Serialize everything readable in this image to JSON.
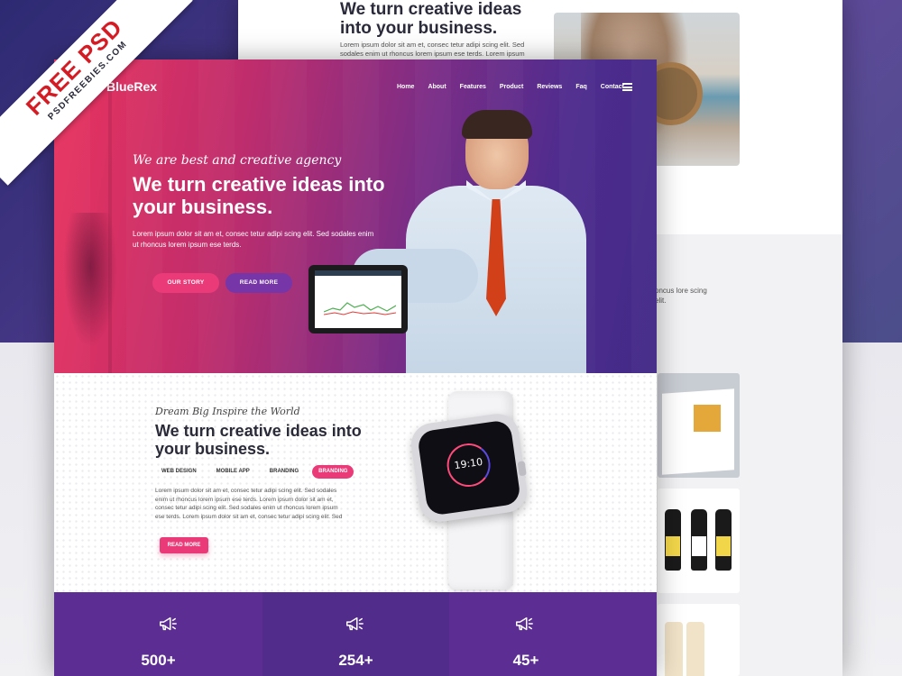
{
  "badge": {
    "main": "FREE PSD",
    "sub": "PSDFREEBIES.COM"
  },
  "back_page": {
    "title": "We  turn creative ideas into your business.",
    "text": "Lorem ipsum dolor sit am et, consec tetur adipi scing elit. Sed sodales enim ut rhoncus lorem ipsum ese terds. Lorem ipsum",
    "side_text": "oncus lore scing elit."
  },
  "header": {
    "logo": "BlueRex",
    "nav": [
      "Home",
      "About",
      "Features",
      "Product",
      "Reviews",
      "Faq",
      "Contact"
    ]
  },
  "hero": {
    "tagline": "We are best and creative agency",
    "title": "We  turn creative ideas into your business.",
    "text": "Lorem ipsum dolor sit am et, consec tetur adipi scing elit. Sed sodales enim ut rhoncus lorem ipsum ese terds.",
    "btn_story": "OUR STORY",
    "btn_read": "READ MORE"
  },
  "section2": {
    "tagline": "Dream Big Inspire the World",
    "title": "We  turn creative ideas into your business.",
    "tabs": [
      "WEB DESIGN",
      "MOBILE APP",
      "BRANDING",
      "BRANDING"
    ],
    "active_tab": 3,
    "text": "Lorem ipsum dolor sit am et, consec tetur adipi scing elit. Sed sodales enim ut rhoncus lorem ipsum ese terds. Lorem ipsum dolor sit am et, consec tetur adipi scing elit. Sed sodales enim ut rhoncus lorem ipsum ese terds. Lorem ipsum dolor sit am et, consec tetur adipi scing elit. Sed",
    "btn": "READ MORE",
    "watch_time": "19:10"
  },
  "stats": [
    {
      "value": "500+",
      "icon": "megaphone-icon"
    },
    {
      "value": "254+",
      "icon": "megaphone-icon"
    },
    {
      "value": "45+",
      "icon": "megaphone-icon"
    }
  ],
  "colors": {
    "pink": "#ea3a78",
    "purple": "#7636a8",
    "stat_purple": "#5c2e93",
    "badge_red": "#d41c24"
  }
}
